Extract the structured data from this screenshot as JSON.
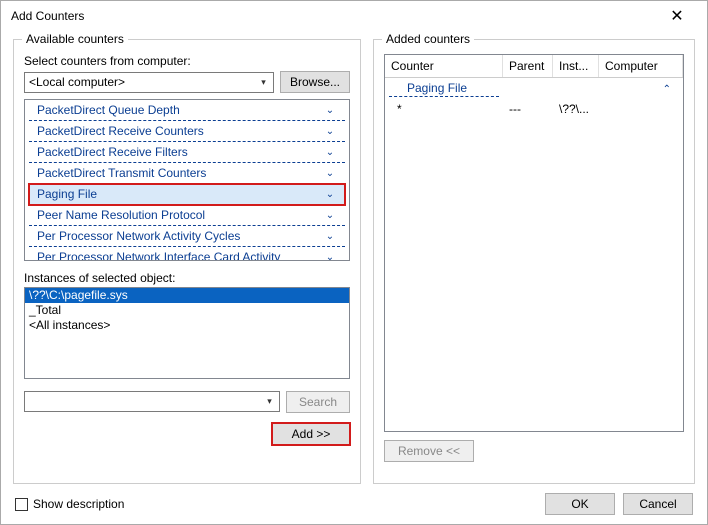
{
  "window": {
    "title": "Add Counters"
  },
  "available": {
    "legend": "Available counters",
    "select_label": "Select counters from computer:",
    "computer_value": "<Local computer>",
    "browse": "Browse...",
    "items": [
      "PacketDirect Queue Depth",
      "PacketDirect Receive Counters",
      "PacketDirect Receive Filters",
      "PacketDirect Transmit Counters",
      "Paging File",
      "Peer Name Resolution Protocol",
      "Per Processor Network Activity Cycles",
      "Per Processor Network Interface Card Activity"
    ],
    "highlight_index": 4,
    "instances_label": "Instances of selected object:",
    "instances": [
      "\\??\\C:\\pagefile.sys",
      "_Total",
      "<All instances>"
    ],
    "instance_selected_index": 0,
    "search_value": "",
    "search_btn": "Search",
    "add_btn": "Add >>"
  },
  "added": {
    "legend": "Added counters",
    "columns": {
      "counter": "Counter",
      "parent": "Parent",
      "inst": "Inst...",
      "computer": "Computer"
    },
    "group": "Paging File",
    "rows": [
      {
        "counter": "*",
        "parent": "---",
        "inst": "\\??\\...",
        "computer": ""
      }
    ],
    "remove_btn": "Remove <<"
  },
  "footer": {
    "show_desc": "Show description",
    "ok": "OK",
    "cancel": "Cancel"
  }
}
